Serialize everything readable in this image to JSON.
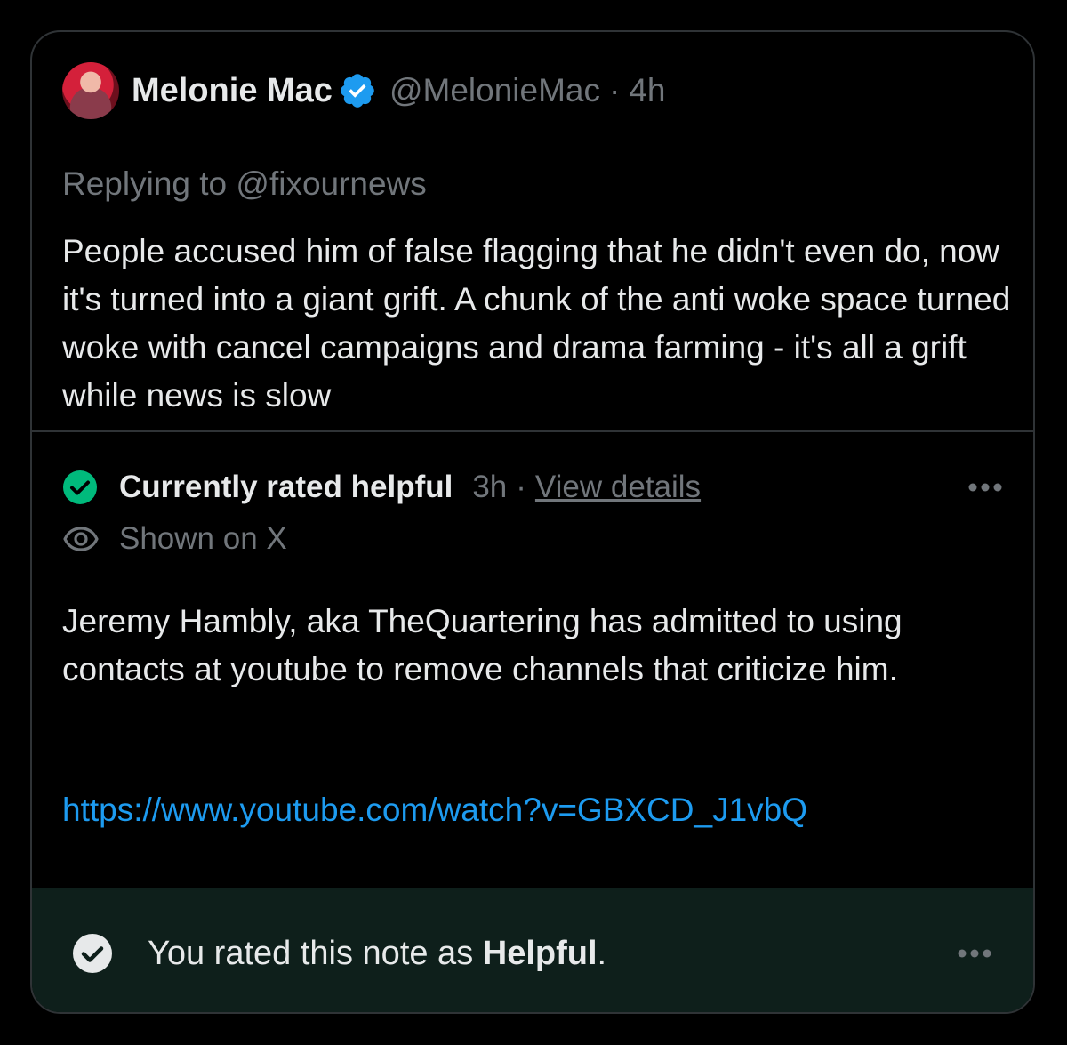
{
  "tweet": {
    "display_name": "Melonie Mac",
    "handle": "@MelonieMac",
    "separator": "·",
    "time": "4h",
    "replying_to": "Replying to @fixournews",
    "text": "People accused him of false flagging that he didn't even do, now it's turned into a giant grift. A chunk of the anti woke space turned woke with cancel campaigns and drama farming - it's all a grift while news is slow"
  },
  "note": {
    "status_label": "Currently rated helpful",
    "status_time": "3h",
    "separator": "·",
    "view_details": "View details",
    "shown_label": "Shown on X",
    "text": "Jeremy Hambly, aka TheQuartering has admitted to using contacts at youtube to remove channels that criticize him.",
    "link": "https://www.youtube.com/watch?v=GBXCD_J1vbQ"
  },
  "footer": {
    "text_prefix": "You rated this note as ",
    "text_bold": "Helpful",
    "text_suffix": "."
  },
  "icons": {
    "verified": "verified-badge-icon",
    "helpful_check": "check-circle-icon",
    "eye": "eye-icon",
    "more": "more-horizontal-icon",
    "rated_check": "check-circle-icon"
  },
  "colors": {
    "background": "#000000",
    "text_primary": "#e7e9ea",
    "text_secondary": "#71767b",
    "link": "#1d9bf0",
    "verified_blue": "#1d9bf0",
    "helpful_green": "#00ba7c",
    "footer_bg": "#0e1f1b",
    "border": "#2f3336"
  }
}
